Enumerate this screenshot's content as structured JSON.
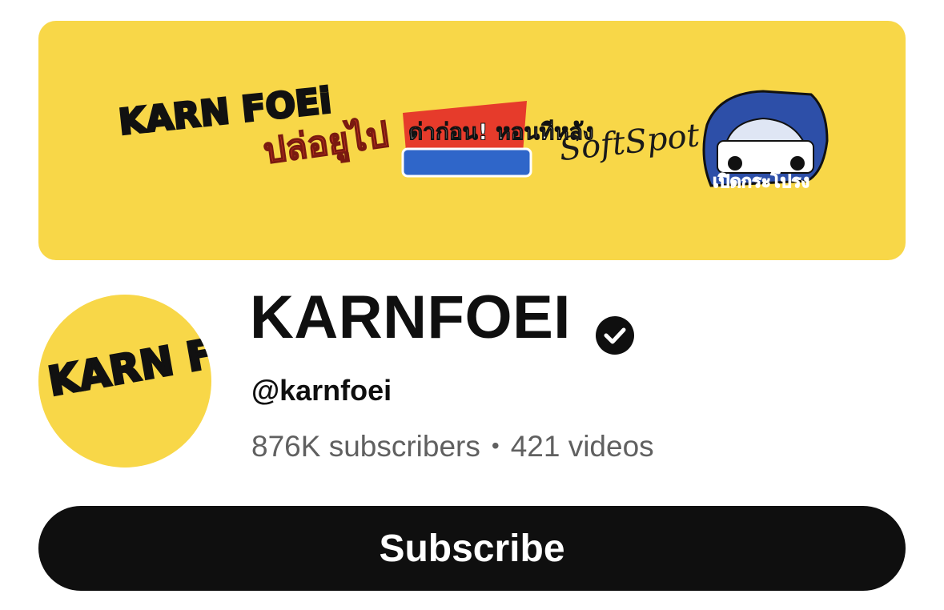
{
  "channel": {
    "name": "KARNFOEI",
    "handle": "@karnfoei",
    "subscribers": "876K subscribers",
    "separator": "•",
    "videos": "421 videos"
  },
  "banner": {
    "logos": [
      {
        "icon": "karnfoei-logo",
        "text": "KARN FOEi"
      },
      {
        "icon": "thai-show-logo-1",
        "text": "ปล่อยูไป"
      },
      {
        "icon": "thai-show-logo-2",
        "text": "ด่าก่อน! หอนทีหลัง"
      },
      {
        "icon": "softspot-logo",
        "text": "SoftSpot"
      },
      {
        "icon": "car-show-logo",
        "text": "เปิดกระโปรง"
      }
    ]
  },
  "avatar": {
    "icon": "karnfoei-logo",
    "text": "KARN FOEi"
  },
  "actions": {
    "subscribe_label": "Subscribe"
  },
  "colors": {
    "brand_yellow": "#f8d748",
    "text_primary": "#0f0f0f",
    "text_secondary": "#606060",
    "button_bg": "#0f0f0f",
    "button_text": "#ffffff"
  }
}
